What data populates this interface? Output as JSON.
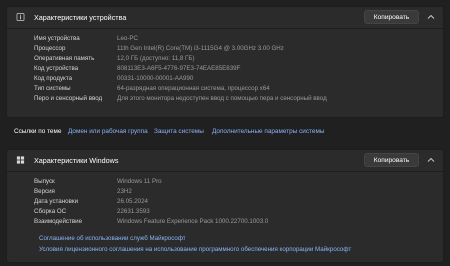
{
  "device_card": {
    "title": "Характеристики устройства",
    "copy_label": "Копировать",
    "specs": [
      {
        "key": "Имя устройства",
        "value": "Leo-PC"
      },
      {
        "key": "Процессор",
        "value": "11th Gen Intel(R) Core(TM) i3-1115G4 @ 3.00GHz   3.00 GHz"
      },
      {
        "key": "Оперативная память",
        "value": "12,0 ГБ (доступно: 11,8 ГБ)"
      },
      {
        "key": "Код устройства",
        "value": "808113E3-A6F5-4776-97E3-74EAE85E839F"
      },
      {
        "key": "Код продукта",
        "value": "00331-10000-00001-AA990"
      },
      {
        "key": "Тип системы",
        "value": "64-разрядная операционная система, процессор x64"
      },
      {
        "key": "Перо и сенсорный ввод",
        "value": "Для этого монитора недоступен ввод с помощью пера и сенсорный ввод"
      }
    ]
  },
  "related_links": {
    "label": "Ссылки по теме",
    "links": [
      "Домен или рабочая группа",
      "Защита системы",
      "Дополнительные параметры системы"
    ]
  },
  "windows_card": {
    "title": "Характеристики Windows",
    "copy_label": "Копировать",
    "specs": [
      {
        "key": "Выпуск",
        "value": "Windows 11 Pro"
      },
      {
        "key": "Версия",
        "value": "23H2"
      },
      {
        "key": "Дата установки",
        "value": "26.05.2024"
      },
      {
        "key": "Сборка ОС",
        "value": "22631.3593"
      },
      {
        "key": "Взаимодействие",
        "value": "Windows Feature Experience Pack 1000.22700.1003.0"
      }
    ],
    "links": [
      "Соглашение об использовании служб Майкрософт",
      "Условия лицензионного соглашения на использование программного обеспечения корпорации Майкрософт"
    ]
  },
  "colors": {
    "background": "#202020",
    "card": "#2b2b2b",
    "link": "#8ab4f8",
    "muted_text": "#9a9a9a"
  },
  "icons": {
    "device_card": "info-icon",
    "windows_card": "windows-logo-icon",
    "collapse": "chevron-up-icon"
  }
}
